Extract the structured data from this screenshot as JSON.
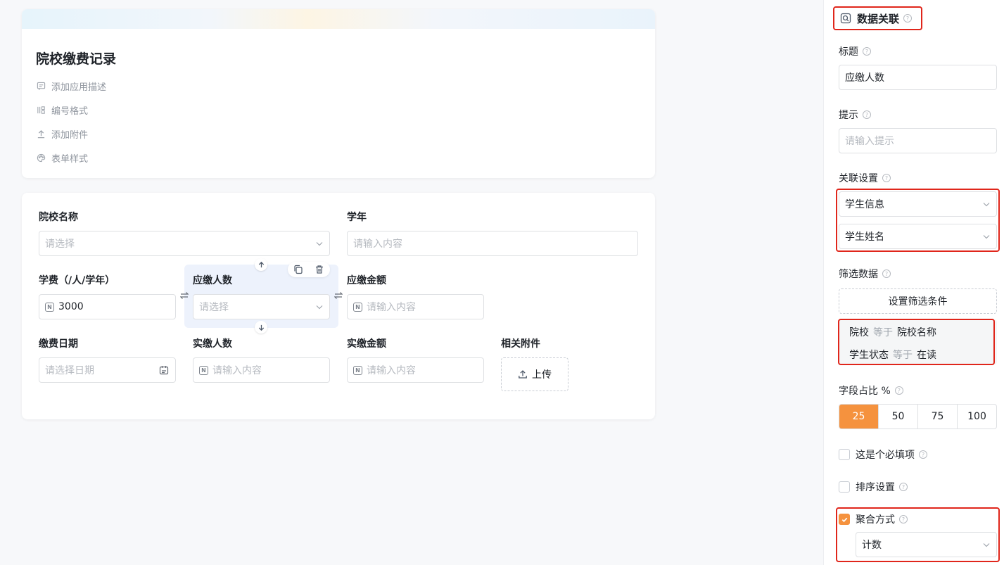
{
  "app": {
    "title": "院校缴费记录",
    "meta": [
      {
        "icon": "description-icon",
        "label": "添加应用描述"
      },
      {
        "icon": "number-format-icon",
        "label": "编号格式"
      },
      {
        "icon": "attachment-icon",
        "label": "添加附件"
      },
      {
        "icon": "form-style-icon",
        "label": "表单样式"
      }
    ]
  },
  "form": {
    "school_name": {
      "label": "院校名称",
      "placeholder": "请选择"
    },
    "school_year": {
      "label": "学年",
      "placeholder": "请输入内容"
    },
    "tuition": {
      "label": "学费（/人/学年）",
      "value": "3000"
    },
    "payable_count": {
      "label": "应缴人数",
      "placeholder": "请选择"
    },
    "payable_amount": {
      "label": "应缴金额",
      "placeholder": "请输入内容"
    },
    "pay_date": {
      "label": "缴费日期",
      "placeholder": "请选择日期"
    },
    "paid_count": {
      "label": "实缴人数",
      "placeholder": "请输入内容"
    },
    "paid_amount": {
      "label": "实缴金额",
      "placeholder": "请输入内容"
    },
    "attachments": {
      "label": "相关附件",
      "button": "上传"
    }
  },
  "panel": {
    "title": "数据关联",
    "title_field": {
      "label": "标题",
      "value": "应缴人数"
    },
    "hint_field": {
      "label": "提示",
      "placeholder": "请输入提示"
    },
    "relation": {
      "label": "关联设置",
      "source": "学生信息",
      "field": "学生姓名"
    },
    "filter": {
      "label": "筛选数据",
      "button": "设置筛选条件",
      "conditions": [
        {
          "field": "院校",
          "op": "等于",
          "value": "院校名称"
        },
        {
          "field": "学生状态",
          "op": "等于",
          "value": "在读"
        }
      ]
    },
    "ratio": {
      "label": "字段占比 %",
      "options": [
        "25",
        "50",
        "75",
        "100"
      ],
      "selected": "25"
    },
    "required": {
      "label": "这是个必填项",
      "checked": false
    },
    "sort": {
      "label": "排序设置",
      "checked": false
    },
    "aggregate": {
      "label": "聚合方式",
      "checked": true,
      "value": "计数"
    }
  },
  "colors": {
    "accent": "#f5923e",
    "highlight": "#e0261b",
    "selected_bg": "#edf2fc"
  }
}
